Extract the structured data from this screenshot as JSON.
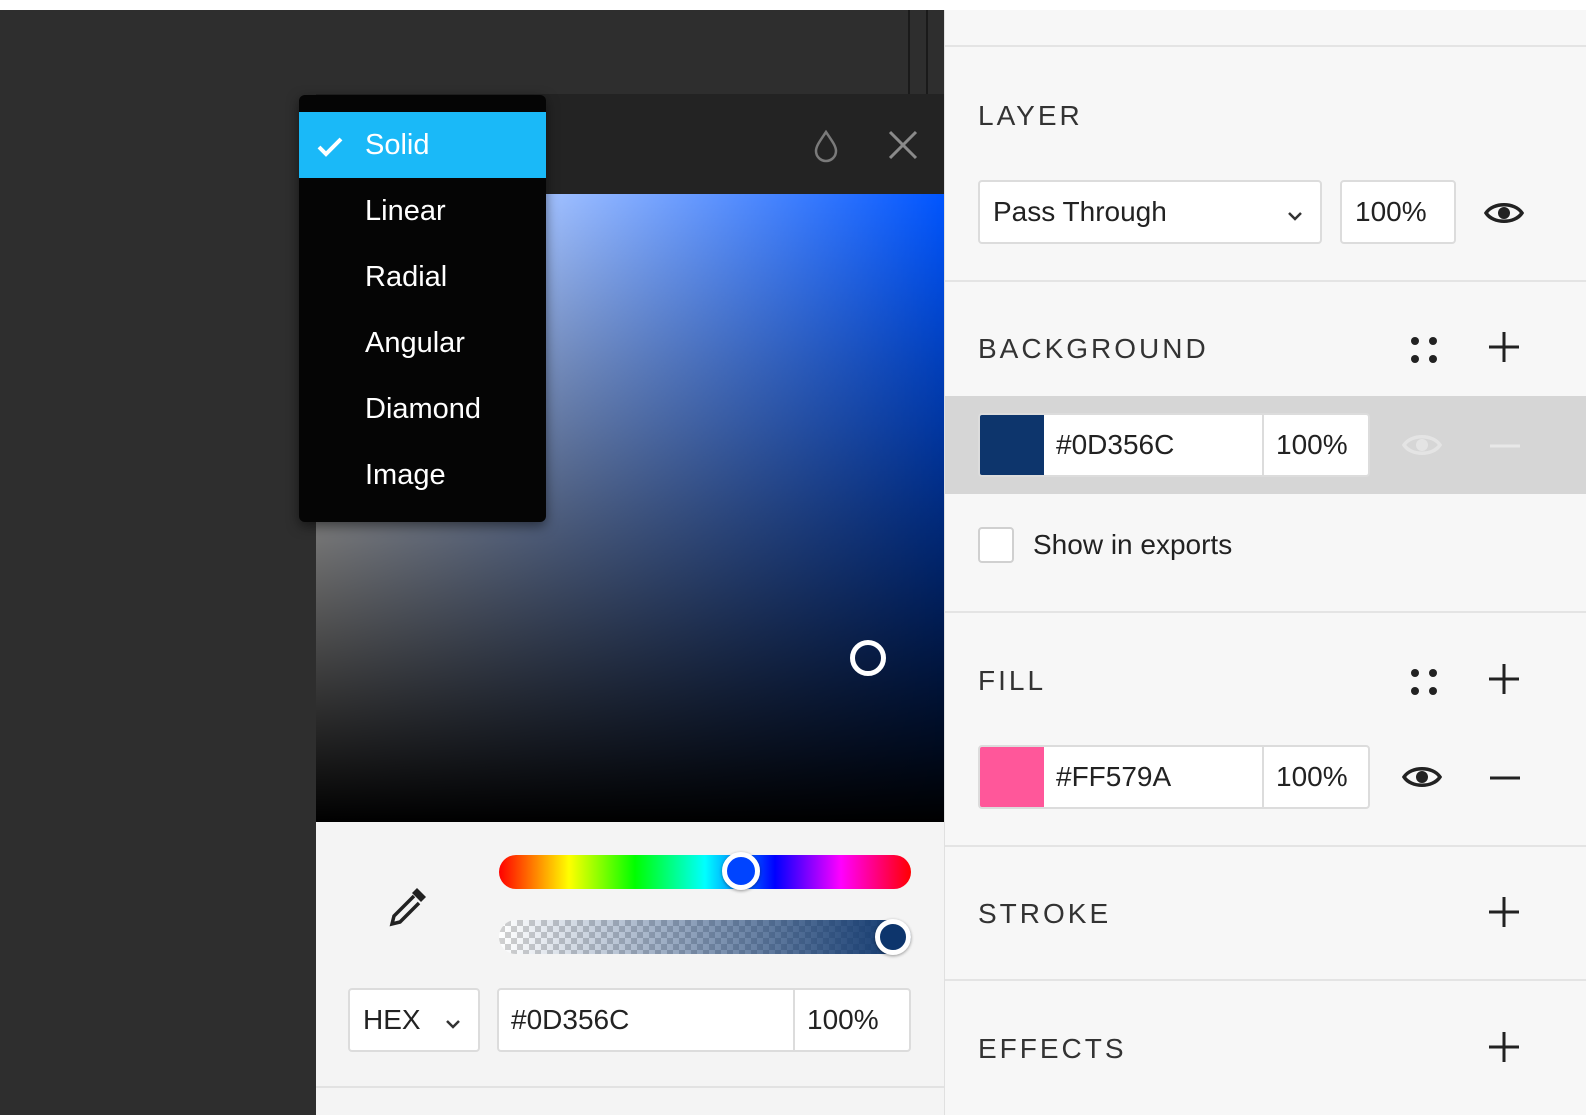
{
  "picker": {
    "fill_type_menu": [
      {
        "label": "Solid",
        "selected": true
      },
      {
        "label": "Linear",
        "selected": false
      },
      {
        "label": "Radial",
        "selected": false
      },
      {
        "label": "Angular",
        "selected": false
      },
      {
        "label": "Diamond",
        "selected": false
      },
      {
        "label": "Image",
        "selected": false
      }
    ],
    "header_icons": [
      "opacity-drop-icon",
      "close-icon"
    ],
    "format": "HEX",
    "hex": "#0D356C",
    "opacity": "100%",
    "color": "#0D356C"
  },
  "panel": {
    "layer": {
      "title": "LAYER",
      "blend_mode": "Pass Through",
      "opacity": "100%"
    },
    "background": {
      "title": "BACKGROUND",
      "hex": "#0D356C",
      "opacity": "100%",
      "swatch_color": "#0D356C",
      "show_in_exports_label": "Show in exports",
      "show_in_exports_checked": false
    },
    "fill": {
      "title": "FILL",
      "hex": "#FF579A",
      "opacity": "100%",
      "swatch_color": "#FF579A"
    },
    "stroke": {
      "title": "STROKE"
    },
    "effects": {
      "title": "EFFECTS"
    }
  },
  "colors": {
    "accent": "#1AB9F8",
    "canvas_bg": "#2E2E2E",
    "panel_bg": "#F7F7F7"
  }
}
